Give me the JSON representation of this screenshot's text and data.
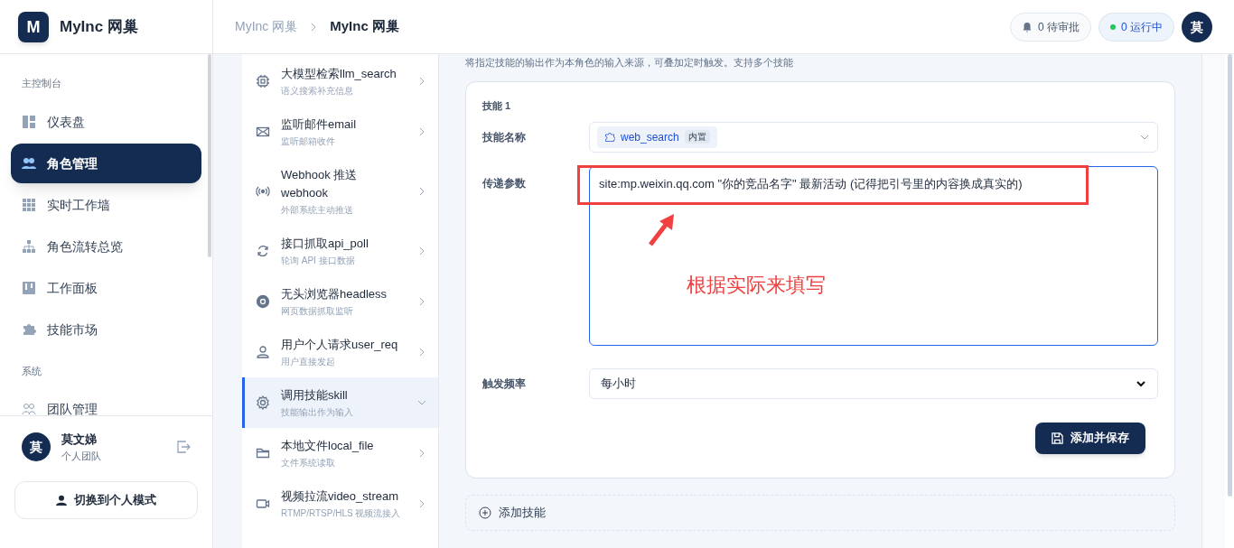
{
  "brand": {
    "logo": "M",
    "name": "MyInc 网巢"
  },
  "breadcrumb": [
    "MyInc 网巢",
    "MyInc 网巢"
  ],
  "header": {
    "pending": "0 待审批",
    "running": "0 运行中",
    "avatar": "莫"
  },
  "sidebar": {
    "sections": [
      {
        "title": "主控制台",
        "items": [
          {
            "kind": "dashboard",
            "label": "仪表盘",
            "selected": false
          },
          {
            "kind": "users",
            "label": "角色管理",
            "selected": true
          },
          {
            "kind": "grid",
            "label": "实时工作墙",
            "selected": false
          },
          {
            "kind": "flow",
            "label": "角色流转总览",
            "selected": false
          },
          {
            "kind": "board",
            "label": "工作面板",
            "selected": false
          },
          {
            "kind": "puzzle",
            "label": "技能市场",
            "selected": false
          }
        ]
      },
      {
        "title": "系统",
        "items": [
          {
            "kind": "team",
            "label": "团队管理",
            "selected": false
          }
        ]
      }
    ],
    "user": {
      "avatar": "莫",
      "name": "莫文娣",
      "team": "个人团队"
    },
    "switch_button": "切换到个人模式"
  },
  "sources": [
    {
      "kind": "chip",
      "title": "大模型检索llm_search",
      "desc": "语义搜索补充信息",
      "expanded": false
    },
    {
      "kind": "mail",
      "title": "监听邮件email",
      "desc": "监听邮箱收件",
      "expanded": false
    },
    {
      "kind": "signal",
      "title": "Webhook 推送 webhook",
      "desc": "外部系统主动推送",
      "expanded": false
    },
    {
      "kind": "refresh",
      "title": "接口抓取api_poll",
      "desc": "轮询 API 接口数据",
      "expanded": false
    },
    {
      "kind": "browser",
      "title": "无头浏览器headless",
      "desc": "网页数据抓取监听",
      "expanded": false
    },
    {
      "kind": "user",
      "title": "用户个人请求user_req",
      "desc": "用户直接发起",
      "expanded": false
    },
    {
      "kind": "gear",
      "title": "调用技能skill",
      "desc": "技能输出作为输入",
      "expanded": true
    },
    {
      "kind": "folder",
      "title": "本地文件local_file",
      "desc": "文件系统读取",
      "expanded": false
    },
    {
      "kind": "video",
      "title": "视频拉流video_stream",
      "desc": "RTMP/RTSP/HLS 视频流接入",
      "expanded": false
    }
  ],
  "form": {
    "hint": "将指定技能的输出作为本角色的输入来源，可叠加定时触发。支持多个技能",
    "card_title": "技能 1",
    "name_label": "技能名称",
    "skill_name": "web_search",
    "skill_tag": "内置",
    "params_label": "传递参数",
    "params_value": "site:mp.weixin.qq.com \"你的竞品名字\" 最新活动 (记得把引号里的内容换成真实的)",
    "freq_label": "触发频率",
    "freq_value": "每小时",
    "save_button": "添加并保存",
    "add_skill": "添加技能"
  },
  "annotation": {
    "note": "根据实际来填写"
  }
}
